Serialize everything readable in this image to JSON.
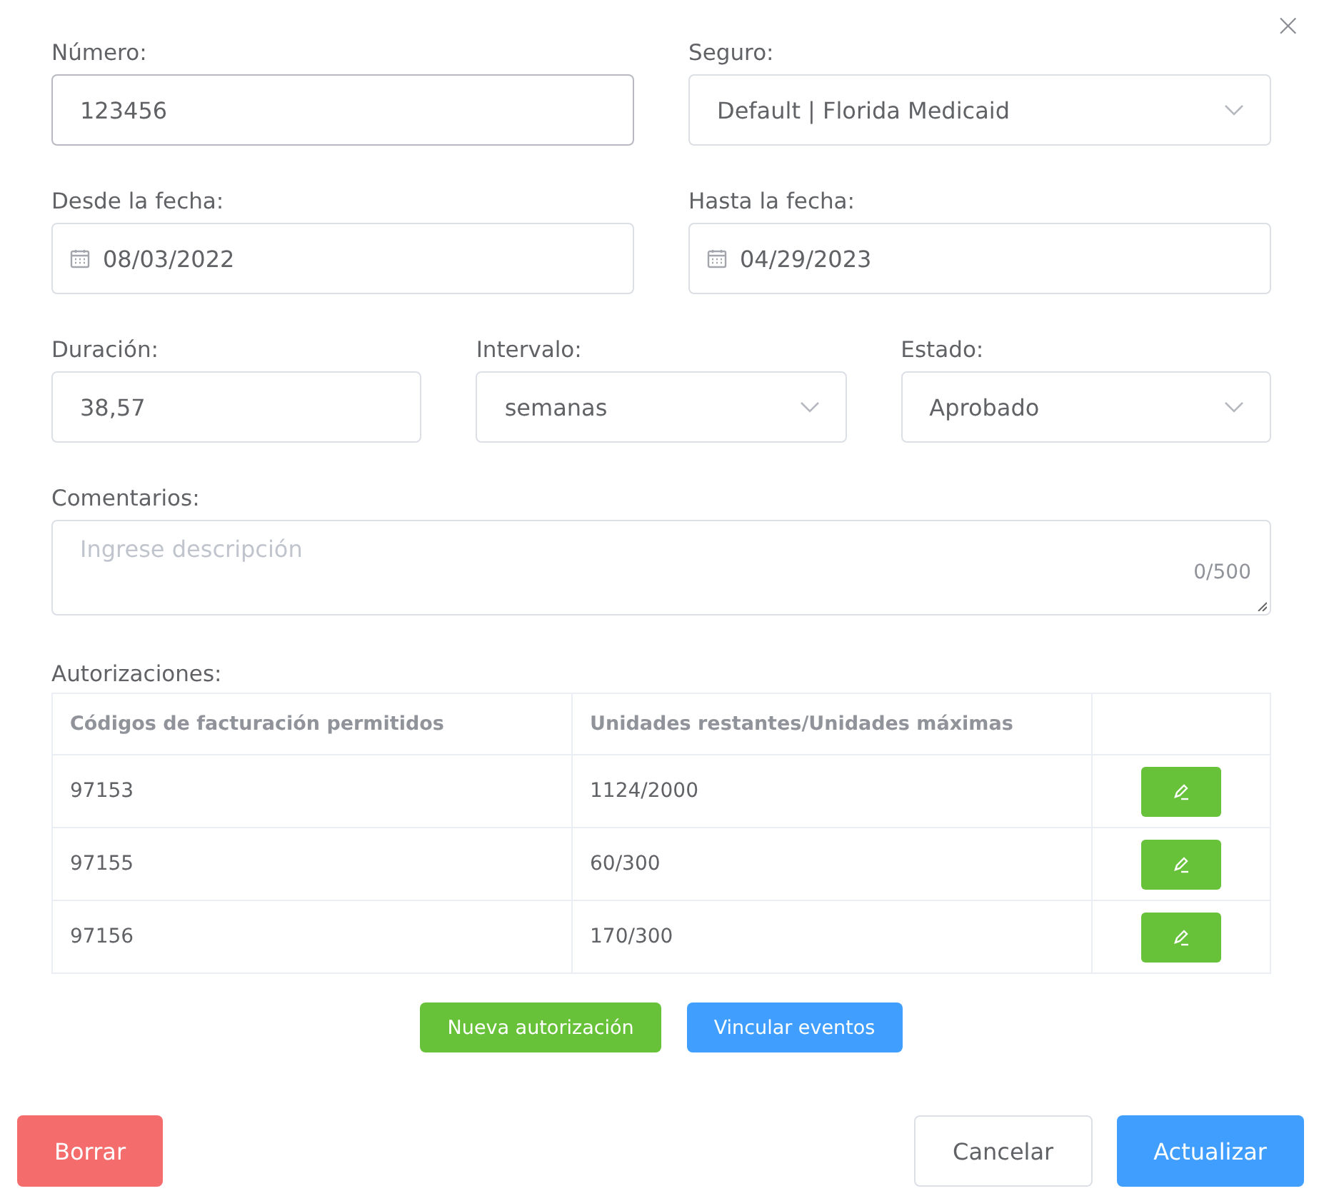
{
  "close": "×",
  "rows": [
    [
      {
        "label": "Número:",
        "kind": "text",
        "value": "123456",
        "focused": true
      },
      {
        "label": "Seguro:",
        "kind": "select",
        "value": "Default | Florida Medicaid",
        "focused": false
      }
    ],
    [
      {
        "label": "Desde la fecha:",
        "kind": "date",
        "value": "08/03/2022",
        "focused": false
      },
      {
        "label": "Hasta la fecha:",
        "kind": "date",
        "value": "04/29/2023",
        "focused": false
      }
    ],
    [
      {
        "label": "Duración:",
        "kind": "text",
        "value": "38,57",
        "focused": false
      },
      {
        "label": "Intervalo:",
        "kind": "select",
        "value": "semanas",
        "focused": false
      },
      {
        "label": "Estado:",
        "kind": "select",
        "value": "Aprobado",
        "focused": false
      }
    ]
  ],
  "comments": {
    "label": "Comentarios:",
    "placeholder": "Ingrese descripción",
    "counter": "0/500"
  },
  "authorizations": {
    "label": "Autorizaciones:",
    "columns": [
      "Códigos de facturación permitidos",
      "Unidades restantes/Unidades máximas"
    ],
    "rows": [
      {
        "code": "97153",
        "units": "1124/2000"
      },
      {
        "code": "97155",
        "units": "60/300"
      },
      {
        "code": "97156",
        "units": "170/300"
      }
    ]
  },
  "actions": [
    {
      "label": "Nueva autorización",
      "kind": "success"
    },
    {
      "label": "Vincular eventos",
      "kind": "primary"
    }
  ],
  "footer": [
    {
      "label": "Borrar",
      "kind": "danger"
    },
    {
      "label": "Cancelar",
      "kind": "default"
    },
    {
      "label": "Actualizar",
      "kind": "primary"
    }
  ]
}
